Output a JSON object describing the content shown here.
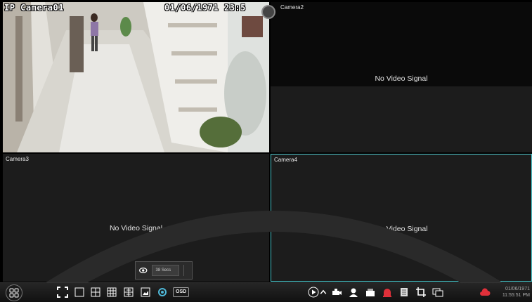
{
  "cameras": [
    {
      "label": "IP Camera01",
      "osd_time": "01/06/1971 23:5",
      "feed": "live"
    },
    {
      "label": "Camera2",
      "status": "No Video Signal"
    },
    {
      "label": "Camera3",
      "status": "No Video Signal"
    },
    {
      "label": "Camera4",
      "status": "No Video Signal",
      "selected": true
    }
  ],
  "sequence_popup": {
    "interval": "38 Secs"
  },
  "taskbar": {
    "osd_label": "OSD",
    "clock_date": "01/06/1971",
    "clock_time": "11:55:51 PM"
  },
  "colors": {
    "selected_border": "#4ecbd0",
    "alarm": "#e0303a",
    "accent": "#4fb8d8"
  }
}
